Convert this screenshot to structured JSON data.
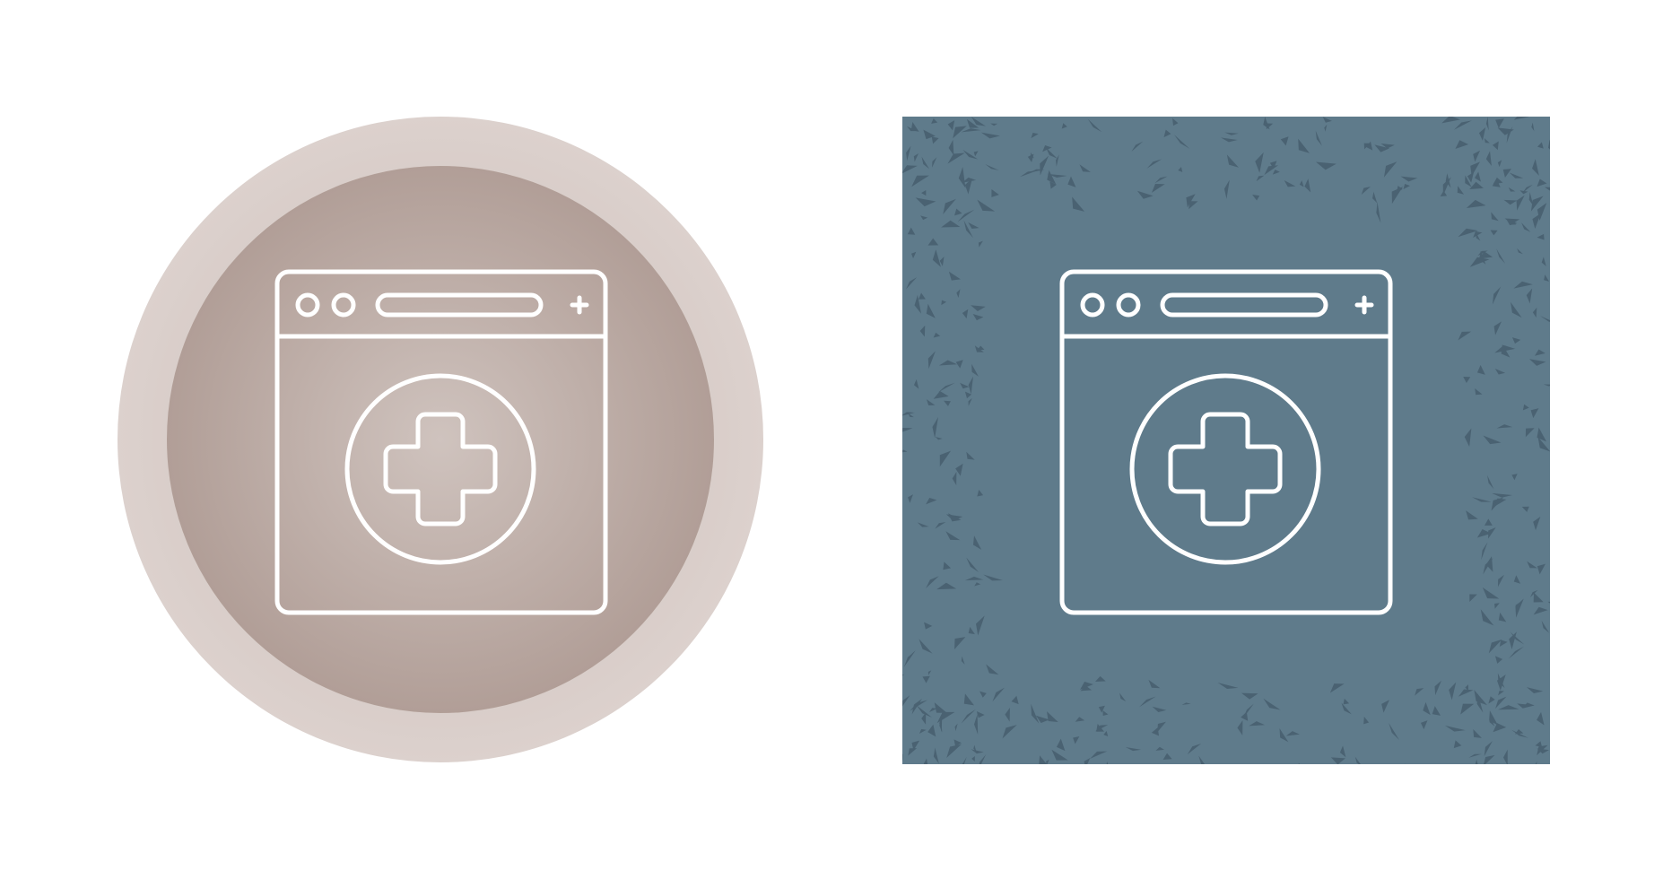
{
  "icons": [
    {
      "name": "medical-website",
      "style": "circle-badge",
      "colors": {
        "outer_ring": "#dcd1cd",
        "inner_disc_edge": "#b19e97",
        "inner_disc_center": "#cfc3be",
        "stroke": "#ffffff"
      }
    },
    {
      "name": "medical-website",
      "style": "grunge-square",
      "colors": {
        "background": "#5f7b8b",
        "grunge_marks": "#4a6272",
        "stroke": "#ffffff"
      }
    }
  ]
}
